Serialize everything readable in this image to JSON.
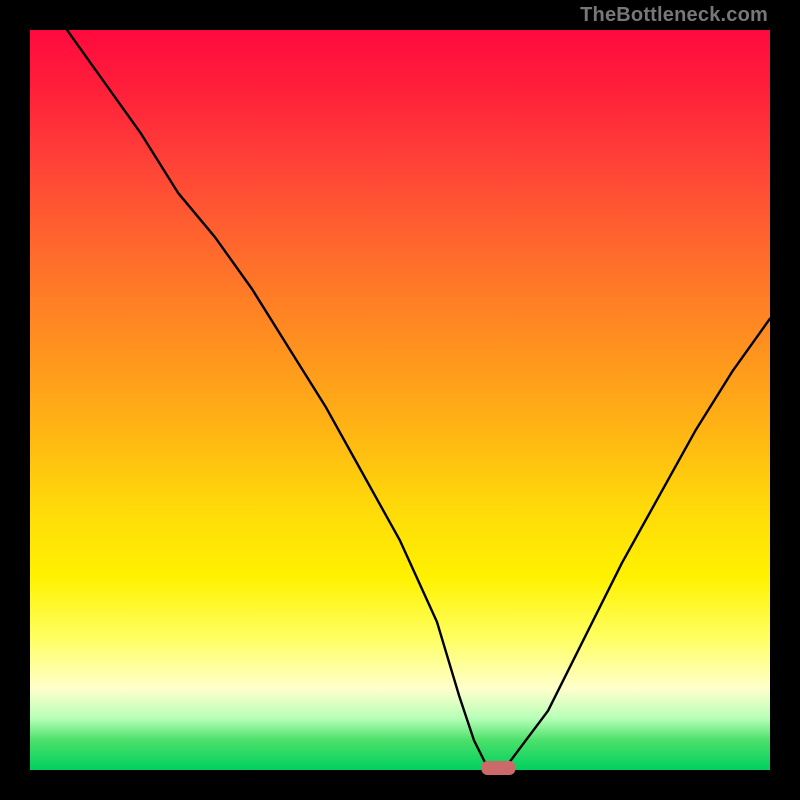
{
  "watermark": "TheBottleneck.com",
  "colors": {
    "frame": "#000000",
    "curve": "#000000",
    "marker": "#cc6a6a",
    "gradient_top": "#ff0a3e",
    "gradient_bottom": "#00d060"
  },
  "chart_data": {
    "type": "line",
    "title": "",
    "xlabel": "",
    "ylabel": "",
    "xlim": [
      0,
      100
    ],
    "ylim": [
      0,
      100
    ],
    "x": [
      5,
      10,
      15,
      20,
      25,
      30,
      35,
      40,
      45,
      50,
      55,
      58,
      60,
      62,
      64,
      70,
      75,
      80,
      85,
      90,
      95,
      100
    ],
    "values": [
      100,
      93,
      86,
      78,
      72,
      65,
      57,
      49,
      40,
      31,
      20,
      10,
      4,
      0,
      0,
      8,
      18,
      28,
      37,
      46,
      54,
      61
    ],
    "marker": {
      "x": 63,
      "y": 0,
      "width": 4,
      "height": 2
    },
    "annotations": []
  }
}
